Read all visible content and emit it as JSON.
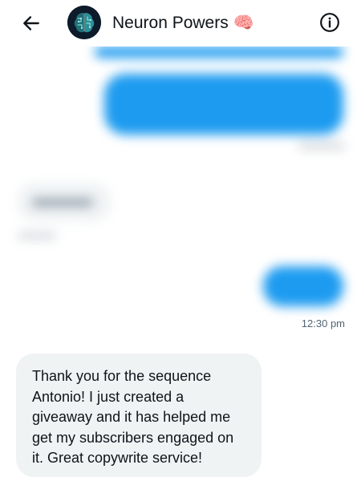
{
  "header": {
    "title": "Neuron Powers 🧠",
    "back_icon": "arrow-left-icon",
    "info_icon": "info-circle-icon",
    "avatar_icon": "brain-avatar-icon"
  },
  "conversation": {
    "visible_timestamp": "12:30 pm",
    "incoming_message": "Thank you for the sequence Antonio! I just created a giveaway and it has helped me get my subscribers engaged on it. Great copywrite service!"
  },
  "colors": {
    "outgoing_bubble": "#1d9bf0",
    "incoming_bubble": "#eff3f4",
    "text": "#0f1419",
    "muted_text": "#536471"
  }
}
